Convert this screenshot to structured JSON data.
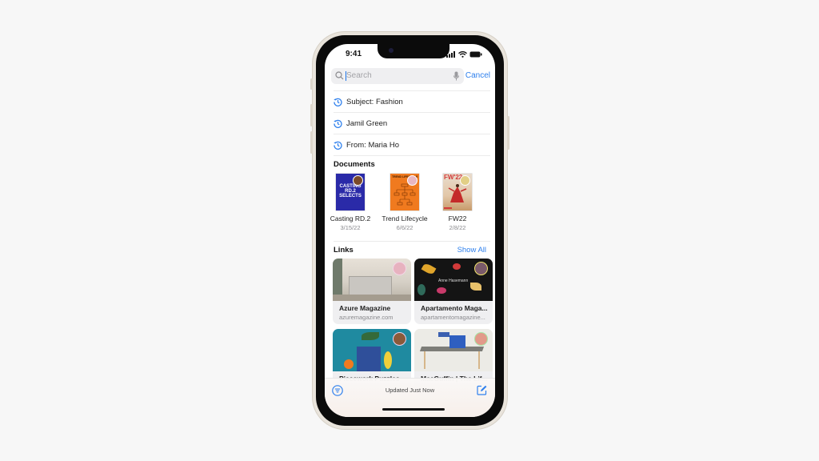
{
  "status_bar": {
    "time": "9:41"
  },
  "search": {
    "placeholder": "Search",
    "cancel_label": "Cancel"
  },
  "suggestions": [
    {
      "label": "Subject: Fashion",
      "icon": "history-icon"
    },
    {
      "label": "Jamil Green",
      "icon": "history-icon"
    },
    {
      "label": "From: Maria Ho",
      "icon": "history-icon"
    }
  ],
  "documents": {
    "title": "Documents",
    "items": [
      {
        "name": "Casting RD.2",
        "date": "3/15/22",
        "cover_text": "CASTING RD.2 SELECTS",
        "color": "#2a2aa8"
      },
      {
        "name": "Trend Lifecycle",
        "date": "6/6/22",
        "cover_text": "TREND LIFECYCLE",
        "color": "#f07a1f"
      },
      {
        "name": "FW22",
        "date": "2/8/22",
        "cover_text": "FW'22",
        "color": "#d33b3b"
      }
    ]
  },
  "links": {
    "title": "Links",
    "show_all_label": "Show All",
    "items": [
      {
        "title": "Azure Magazine",
        "url": "azuremagazine.com"
      },
      {
        "title": "Apartamento Maga...",
        "url": "apartamentomagazine...",
        "overlay": "Anne Hasemann"
      },
      {
        "title": "Piecework Puzzles",
        "url": ""
      },
      {
        "title": "MacGuffin | The Lif...",
        "url": ""
      }
    ]
  },
  "toolbar": {
    "status": "Updated Just Now"
  },
  "colors": {
    "accent": "#2f80ed"
  }
}
